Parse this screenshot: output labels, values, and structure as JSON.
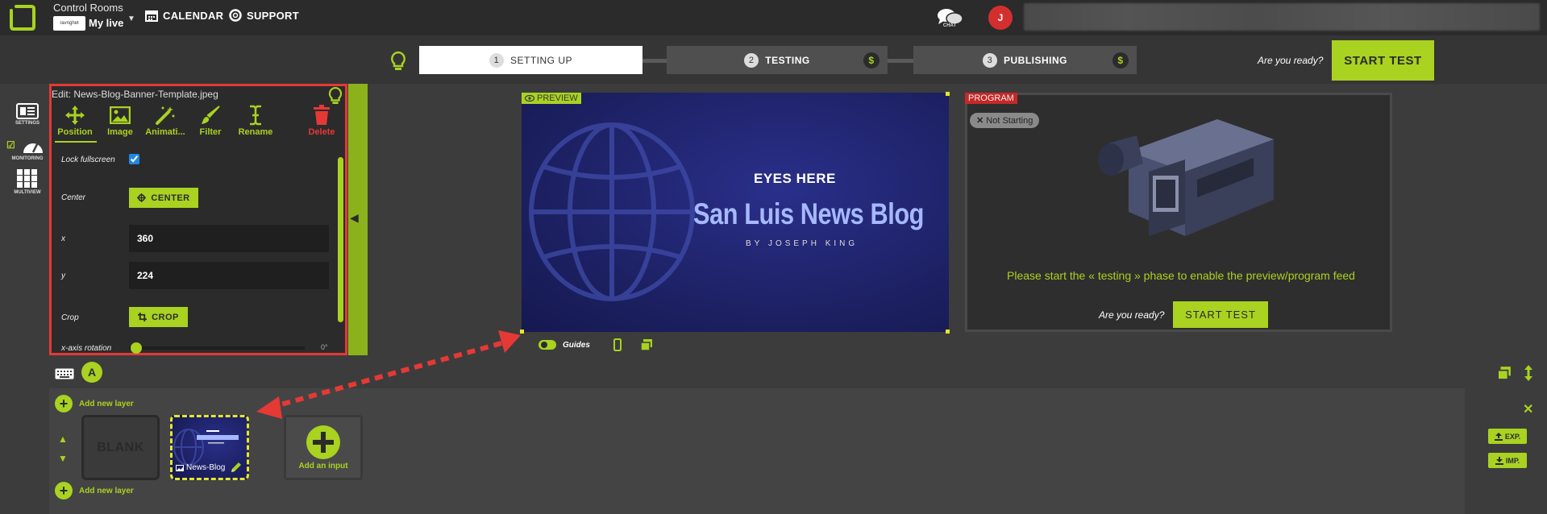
{
  "header": {
    "brand_title": "Control Rooms",
    "brand_logo_text": "ravnghet",
    "brand_name": "My live",
    "nav": [
      {
        "label": "CALENDAR",
        "icon": "calendar-icon"
      },
      {
        "label": "SUPPORT",
        "icon": "support-icon"
      }
    ],
    "chat_label": "CHAT",
    "avatar_letter": "J"
  },
  "steps": [
    {
      "number": "1",
      "label": "SETTING UP",
      "active": true
    },
    {
      "number": "2",
      "label": "TESTING",
      "paid_badge": "$"
    },
    {
      "number": "3",
      "label": "PUBLISHING",
      "paid_badge": "$"
    }
  ],
  "ready_prompt": "Are you ready?",
  "start_test_label": "START TEST",
  "sidebar": [
    {
      "label": "SETTINGS",
      "icon": "settings-icon"
    },
    {
      "label": "MONITORING",
      "icon": "monitoring-gauge-icon"
    },
    {
      "label": "MULTIVIEW",
      "icon": "multiview-grid-icon"
    }
  ],
  "edit_panel": {
    "title": "Edit: News-Blog-Banner-Template.jpeg",
    "tools": [
      {
        "label": "Position",
        "icon": "move-arrows-icon"
      },
      {
        "label": "Image",
        "icon": "image-icon"
      },
      {
        "label": "Animati...",
        "icon": "magic-wand-icon"
      },
      {
        "label": "Filter",
        "icon": "brush-icon"
      },
      {
        "label": "Rename",
        "icon": "text-cursor-icon"
      },
      {
        "label": "Delete",
        "icon": "trash-icon"
      }
    ],
    "lock_fullscreen_label": "Lock fullscreen",
    "lock_fullscreen_checked": true,
    "center_label": "Center",
    "center_button": "CENTER",
    "x_label": "x",
    "x_value": "360",
    "y_label": "y",
    "y_value": "224",
    "crop_label": "Crop",
    "crop_button": "CROP",
    "rotation_label": "x-axis rotation",
    "rotation_value": "0°"
  },
  "preview": {
    "tag": "PREVIEW",
    "eyes_text": "EYES HERE",
    "blog_title": "San Luis News Blog",
    "byline": "BY JOSEPH KING",
    "guides_label": "Guides",
    "guides_on": true
  },
  "program": {
    "tag": "PROGRAM",
    "status": "Not Starting",
    "message": "Please start the « testing » phase to enable the preview/program feed"
  },
  "layers": {
    "active_layer": "A",
    "add_layer_label": "Add new layer",
    "blank_label": "BLANK",
    "item_label": "News-Blog",
    "add_input_label": "Add an input"
  },
  "right_panel": {
    "export_label": "EXP.",
    "import_label": "IMP."
  },
  "colors": {
    "accent": "#a9d221",
    "alert": "#e53935",
    "avatar": "#d32f2f"
  }
}
